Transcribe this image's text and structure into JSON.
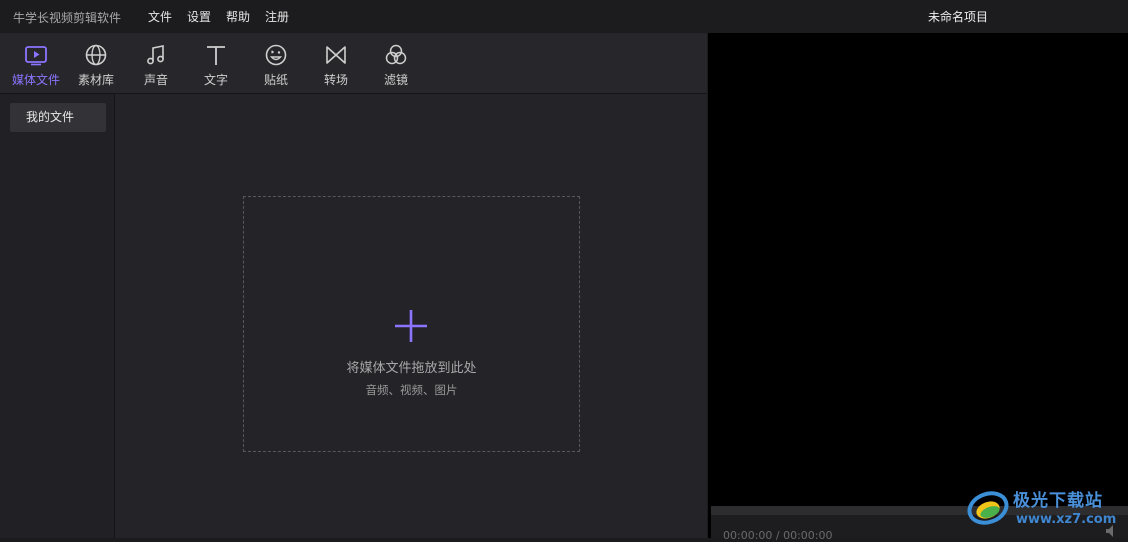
{
  "titlebar": {
    "app_name": "牛学长视频剪辑软件",
    "menu": [
      "文件",
      "设置",
      "帮助",
      "注册"
    ],
    "project_title": "未命名项目"
  },
  "toolbar": {
    "tools": [
      {
        "label": "媒体文件",
        "icon": "media-files-icon",
        "active": true
      },
      {
        "label": "素材库",
        "icon": "globe-icon",
        "active": false
      },
      {
        "label": "声音",
        "icon": "music-note-icon",
        "active": false
      },
      {
        "label": "文字",
        "icon": "text-t-icon",
        "active": false
      },
      {
        "label": "贴纸",
        "icon": "sticker-face-icon",
        "active": false
      },
      {
        "label": "转场",
        "icon": "bowtie-transition-icon",
        "active": false
      },
      {
        "label": "滤镜",
        "icon": "filter-circles-icon",
        "active": false
      }
    ]
  },
  "left_nav": {
    "items": [
      {
        "label": "我的文件"
      }
    ]
  },
  "drop_zone": {
    "title": "将媒体文件拖放到此处",
    "subtitle": "音频、视频、图片"
  },
  "player": {
    "time": "00:00:00 / 00:00:00"
  },
  "watermark": {
    "brand": "极光下载站",
    "url": "www.xz7.com"
  },
  "colors": {
    "accent": "#8d74ff",
    "background": "#232328",
    "preview": "#000000"
  }
}
